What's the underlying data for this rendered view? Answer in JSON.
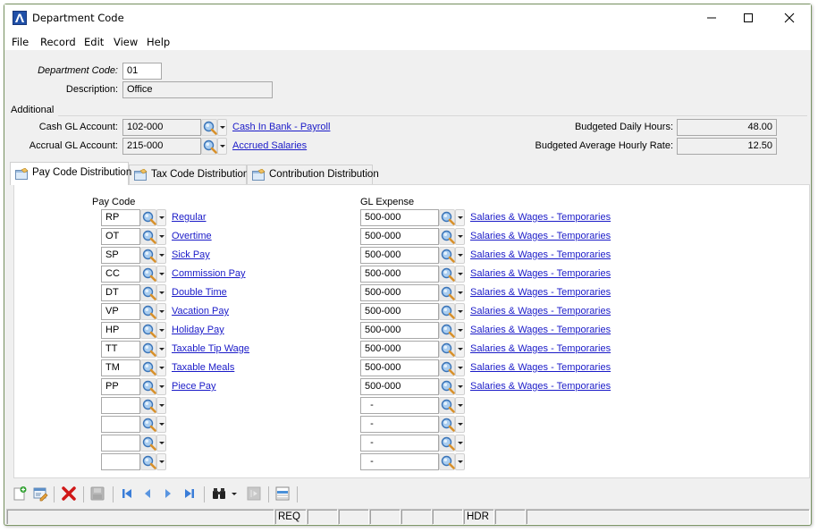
{
  "window": {
    "title": "Department Code",
    "controls": {
      "minimize": "minimize-icon",
      "maximize": "maximize-icon",
      "close": "close-icon"
    }
  },
  "menu": [
    "File",
    "Record",
    "Edit",
    "View",
    "Help"
  ],
  "header": {
    "department_code_label": "Department Code:",
    "department_code_value": "01",
    "description_label": "Description:",
    "description_value": "Office"
  },
  "additional": {
    "group_label": "Additional",
    "cash_gl_label": "Cash GL Account:",
    "cash_gl_value": "102-000",
    "cash_gl_link": "Cash In Bank - Payroll",
    "accrual_gl_label": "Accrual GL Account:",
    "accrual_gl_value": "215-000",
    "accrual_gl_link": "Accrued Salaries",
    "budgeted_daily_hours_label": "Budgeted Daily Hours:",
    "budgeted_daily_hours_value": "48.00",
    "budgeted_avg_rate_label": "Budgeted Average Hourly Rate:",
    "budgeted_avg_rate_value": "12.50"
  },
  "tabs": [
    {
      "label": "Pay Code Distribution",
      "active": true
    },
    {
      "label": "Tax Code Distribution",
      "active": false
    },
    {
      "label": "Contribution Distribution",
      "active": false
    }
  ],
  "grid": {
    "pay_code_header": "Pay Code",
    "gl_expense_header": "GL Expense",
    "rows": [
      {
        "code": "RP",
        "name": "Regular",
        "gl": "500-000",
        "gl_name": "Salaries & Wages - Temporaries"
      },
      {
        "code": "OT",
        "name": "Overtime",
        "gl": "500-000",
        "gl_name": "Salaries & Wages - Temporaries"
      },
      {
        "code": "SP",
        "name": "Sick Pay",
        "gl": "500-000",
        "gl_name": "Salaries & Wages - Temporaries"
      },
      {
        "code": "CC",
        "name": "Commission Pay",
        "gl": "500-000",
        "gl_name": "Salaries & Wages - Temporaries"
      },
      {
        "code": "DT",
        "name": "Double Time",
        "gl": "500-000",
        "gl_name": "Salaries & Wages - Temporaries"
      },
      {
        "code": "VP",
        "name": "Vacation Pay",
        "gl": "500-000",
        "gl_name": "Salaries & Wages - Temporaries"
      },
      {
        "code": "HP",
        "name": "Holiday Pay",
        "gl": "500-000",
        "gl_name": "Salaries & Wages - Temporaries"
      },
      {
        "code": "TT",
        "name": "Taxable Tip Wage",
        "gl": "500-000",
        "gl_name": "Salaries & Wages - Temporaries"
      },
      {
        "code": "TM",
        "name": "Taxable Meals",
        "gl": "500-000",
        "gl_name": "Salaries & Wages - Temporaries"
      },
      {
        "code": "PP",
        "name": "Piece Pay",
        "gl": "500-000",
        "gl_name": "Salaries & Wages - Temporaries"
      },
      {
        "code": "",
        "name": "",
        "gl": "  -",
        "gl_name": ""
      },
      {
        "code": "",
        "name": "",
        "gl": "  -",
        "gl_name": ""
      },
      {
        "code": "",
        "name": "",
        "gl": "  -",
        "gl_name": ""
      },
      {
        "code": "",
        "name": "",
        "gl": "  -",
        "gl_name": ""
      }
    ]
  },
  "toolbar": [
    "new-record-icon",
    "edit-record-icon",
    "delete-icon",
    "save-icon",
    "first-record-icon",
    "previous-record-icon",
    "next-record-icon",
    "last-record-icon",
    "find-icon",
    "import-icon",
    "list-view-icon"
  ],
  "status": {
    "cells": [
      "",
      "REQ",
      "",
      "",
      "",
      "",
      "",
      "HDR",
      "",
      ""
    ]
  }
}
